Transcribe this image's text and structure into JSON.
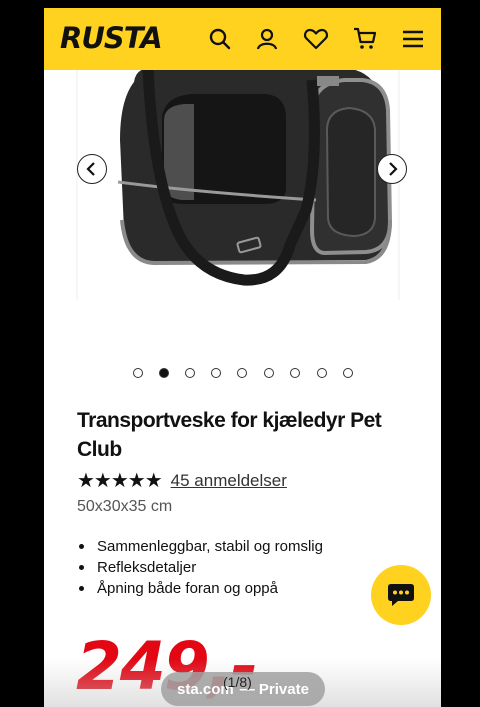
{
  "header": {
    "logo": "RUSTA",
    "icons": [
      "search-icon",
      "user-icon",
      "heart-icon",
      "cart-icon",
      "menu-icon"
    ],
    "background": "#ffd21f"
  },
  "gallery": {
    "image_alt": "Transportveske for kjæledyr Pet Club",
    "active_index": 1,
    "count": 9
  },
  "product": {
    "title": "Transportveske for kjæledyr Pet Club",
    "rating_stars": "★★★★★",
    "rating_value": 4.5,
    "reviews": "45 anmeldelser",
    "dimensions": "50x30x35 cm",
    "features": [
      "Sammenleggbar, stabil og romslig",
      "Refleksdetaljer",
      "Åpning både foran og oppå"
    ],
    "price": "249,-",
    "price_color": "#e30613"
  },
  "browser": {
    "domain": "sta.com",
    "counter": "(1/8)",
    "mode": "— Private"
  }
}
